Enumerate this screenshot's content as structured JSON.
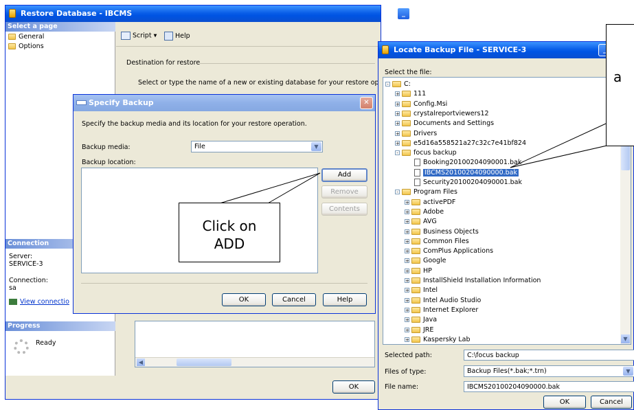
{
  "restore": {
    "title": "Restore Database - IBCMS",
    "select_page_header": "Select a page",
    "pages": [
      "General",
      "Options"
    ],
    "script_label": "Script",
    "help_label": "Help",
    "destination_label": "Destination for restore",
    "destination_text": "Select or type the name of a new or existing database for your restore operation.",
    "connection_header": "Connection",
    "server_label": "Server:",
    "server_value": "SERVICE-3",
    "connection_label": "Connection:",
    "connection_value": "sa",
    "view_link": "View connectio",
    "progress_header": "Progress",
    "progress_status": "Ready",
    "ok_label": "OK"
  },
  "specify": {
    "title": "Specify Backup",
    "instruction": "Specify the backup media and its location for your restore operation.",
    "media_label": "Backup media:",
    "media_value": "File",
    "location_label": "Backup location:",
    "add_label": "Add",
    "remove_label": "Remove",
    "contents_label": "Contents",
    "ok_label": "OK",
    "cancel_label": "Cancel",
    "help_label": "Help"
  },
  "locate": {
    "title": "Locate Backup File - SERVICE-3",
    "select_label": "Select the file:",
    "tree": [
      {
        "label": "C:",
        "level": 0,
        "kind": "folder",
        "pm": "-"
      },
      {
        "label": "111",
        "level": 1,
        "kind": "folder",
        "pm": "+"
      },
      {
        "label": "Config.Msi",
        "level": 1,
        "kind": "folder",
        "pm": "+"
      },
      {
        "label": "crystalreportviewers12",
        "level": 1,
        "kind": "folder",
        "pm": "+"
      },
      {
        "label": "Documents and Settings",
        "level": 1,
        "kind": "folder",
        "pm": "+"
      },
      {
        "label": "Drivers",
        "level": 1,
        "kind": "folder",
        "pm": "+"
      },
      {
        "label": "e5d16a558521a27c32c7e41bf824",
        "level": 1,
        "kind": "folder",
        "pm": "+"
      },
      {
        "label": "focus backup",
        "level": 1,
        "kind": "folder",
        "pm": "-"
      },
      {
        "label": "Booking20100204090001.bak",
        "level": 2,
        "kind": "file",
        "pm": ""
      },
      {
        "label": "IBCMS20100204090000.bak",
        "level": 2,
        "kind": "file",
        "pm": "",
        "selected": true
      },
      {
        "label": "Security20100204090001.bak",
        "level": 2,
        "kind": "file",
        "pm": ""
      },
      {
        "label": "Program Files",
        "level": 1,
        "kind": "folder",
        "pm": "-"
      },
      {
        "label": "activePDF",
        "level": 2,
        "kind": "folder",
        "pm": "+"
      },
      {
        "label": "Adobe",
        "level": 2,
        "kind": "folder",
        "pm": "+"
      },
      {
        "label": "AVG",
        "level": 2,
        "kind": "folder",
        "pm": "+"
      },
      {
        "label": "Business Objects",
        "level": 2,
        "kind": "folder",
        "pm": "+"
      },
      {
        "label": "Common Files",
        "level": 2,
        "kind": "folder",
        "pm": "+"
      },
      {
        "label": "ComPlus Applications",
        "level": 2,
        "kind": "folder",
        "pm": "+"
      },
      {
        "label": "Google",
        "level": 2,
        "kind": "folder",
        "pm": "+"
      },
      {
        "label": "HP",
        "level": 2,
        "kind": "folder",
        "pm": "+"
      },
      {
        "label": "InstallShield Installation Information",
        "level": 2,
        "kind": "folder",
        "pm": "+"
      },
      {
        "label": "Intel",
        "level": 2,
        "kind": "folder",
        "pm": "+"
      },
      {
        "label": "Intel Audio Studio",
        "level": 2,
        "kind": "folder",
        "pm": "+"
      },
      {
        "label": "Internet Explorer",
        "level": 2,
        "kind": "folder",
        "pm": "+"
      },
      {
        "label": "Java",
        "level": 2,
        "kind": "folder",
        "pm": "+"
      },
      {
        "label": "JRE",
        "level": 2,
        "kind": "folder",
        "pm": "+"
      },
      {
        "label": "Kaspersky Lab",
        "level": 2,
        "kind": "folder",
        "pm": "+"
      }
    ],
    "selected_path_label": "Selected path:",
    "selected_path_value": "C:\\focus backup",
    "files_of_type_label": "Files of type:",
    "files_of_type_value": "Backup Files(*.bak;*.trn)",
    "file_name_label": "File name:",
    "file_name_value": "IBCMS20100204090000.bak",
    "ok_label": "OK",
    "cancel_label": "Cancel"
  },
  "callouts": {
    "add_callout": "Click on ADD",
    "file_callout_partial": "a"
  }
}
